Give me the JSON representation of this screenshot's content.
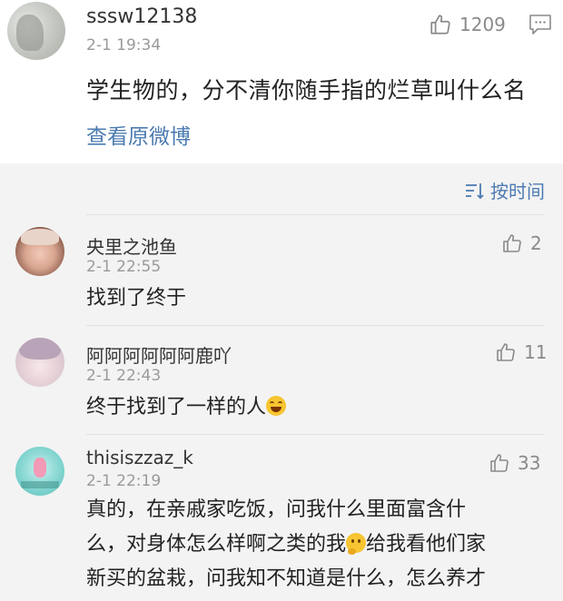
{
  "original_post": {
    "username": "sssw12138",
    "time": "2-1 19:34",
    "like_count": "1209",
    "text": "学生物的，分不清你随手指的烂草叫什么名",
    "view_original_label": "查看原微博"
  },
  "sort_label": "按时间",
  "comments": [
    {
      "username": "央里之池鱼",
      "time": "2-1 22:55",
      "like_count": "2",
      "text": "找到了终于"
    },
    {
      "username": "阿阿阿阿阿阿鹿吖",
      "time": "2-1 22:43",
      "like_count": "11",
      "text": "终于找到了一样的人",
      "emoji": "laughing-tears-emoji"
    },
    {
      "username": "thisiszzaz_k",
      "time": "2-1 22:19",
      "like_count": "33",
      "text_line1": "真的，在亲戚家吃饭，问我什么里面富含什",
      "text_line2a": "么，对身体怎么样啊之类的我",
      "text_line2b": "给我看他们家",
      "text_line3": "新买的盆栽，问我知不知道是什么，怎么养才",
      "emoji": "thinking-emoji"
    }
  ],
  "colors": {
    "link": "#4c7bb1",
    "meta": "#9a9a9a",
    "comments_bg": "#f3f3f3"
  }
}
